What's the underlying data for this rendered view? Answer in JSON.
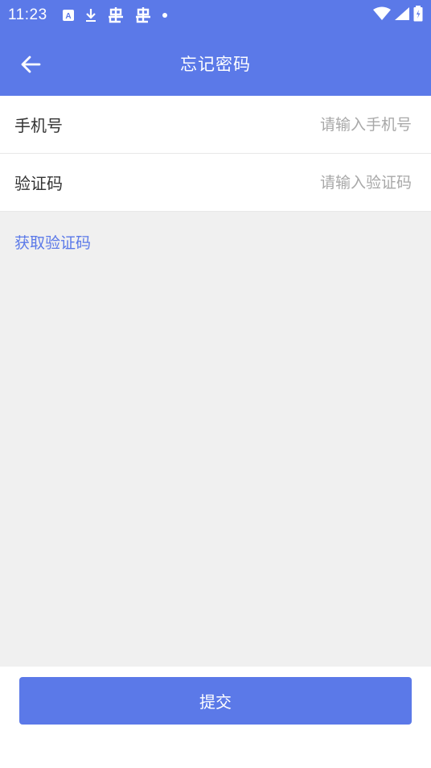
{
  "status_bar": {
    "time": "11:23",
    "icons": [
      "font-a-icon",
      "download-icon",
      "bug-icon",
      "bug-icon",
      "dot-icon",
      "wifi-icon",
      "signal-icon",
      "battery-icon"
    ]
  },
  "app_bar": {
    "title": "忘记密码"
  },
  "form": {
    "phone_label": "手机号",
    "phone_placeholder": "请输入手机号",
    "code_label": "验证码",
    "code_placeholder": "请输入验证码",
    "get_code_link": "获取验证码"
  },
  "footer": {
    "submit_label": "提交"
  },
  "colors": {
    "primary": "#5b79e8",
    "background": "#f0f0f0"
  }
}
